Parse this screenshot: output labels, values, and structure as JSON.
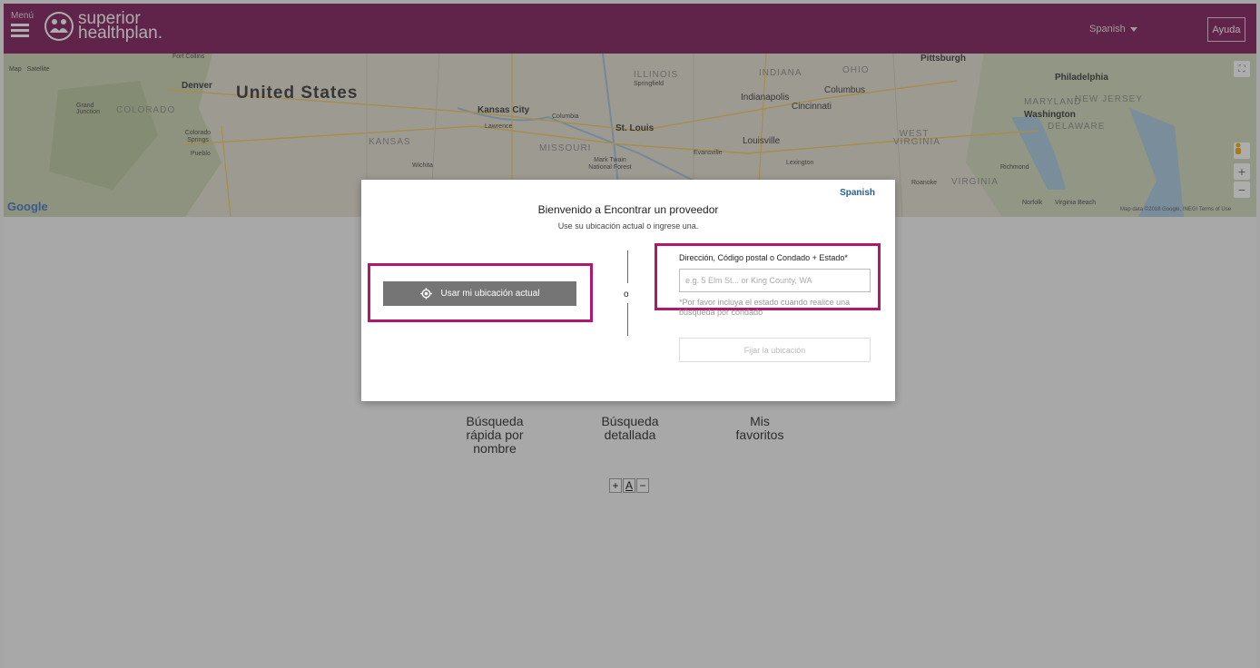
{
  "header": {
    "menu_label": "Menú",
    "logo_line1": "superior",
    "logo_line2": "healthplan.",
    "language": "Spanish",
    "help": "Ayuda"
  },
  "map": {
    "type_map": "Map",
    "type_satellite": "Satellite",
    "google": "Google",
    "attribution": "Map data ©2018 Google, INEGI   Terms of Use",
    "labels": {
      "fort_collins": "Fort Collins",
      "denver": "Denver",
      "united_states": "United States",
      "grand_junction": "Grand Junction",
      "colorado": "COLORADO",
      "colorado_springs": "Colorado Springs",
      "pueblo": "Pueblo",
      "kansas": "KANSAS",
      "wichita": "Wichita",
      "kansas_city": "Kansas City",
      "lawrence": "Lawrence",
      "columbia": "Columbia",
      "missouri": "MISSOURI",
      "st_louis": "St. Louis",
      "mark_twain": "Mark Twain National Forest",
      "illinois": "ILLINOIS",
      "springfield": "Springfield",
      "indiana": "INDIANA",
      "indianapolis": "Indianapolis",
      "ohio": "OHIO",
      "columbus": "Columbus",
      "cincinnati": "Cincinnati",
      "louisville": "Louisville",
      "evansville": "Evansville",
      "lexington": "Lexington",
      "pittsburgh": "Pittsburgh",
      "west_virginia": "WEST VIRGINIA",
      "philadelphia": "Philadelphia",
      "maryland": "MARYLAND",
      "new_jersey": "NEW JERSEY",
      "washington": "Washington",
      "delaware": "DELAWARE",
      "richmond": "Richmond",
      "virginia": "VIRGINIA",
      "roanoke": "Roanoke",
      "norfolk": "Norfolk",
      "virginia_beach": "Virginia Beach"
    }
  },
  "nav": {
    "quick_search": "Búsqueda rápida por nombre",
    "detailed_search": "Búsqueda detallada",
    "favorites": "Mis favoritos"
  },
  "font_controls": {
    "plus": "+",
    "a": "A",
    "minus": "−"
  },
  "modal": {
    "language": "Spanish",
    "title": "Bienvenido a Encontrar un proveedor",
    "subtitle": "Use su ubicación actual o ingrese una.",
    "use_location_button": "Usar mi ubicación actual",
    "or": "o",
    "field_label": "Dirección, Código postal o Condado + Estado*",
    "field_placeholder": "e.g. 5 Elm St... or King County, WA",
    "field_value": "",
    "hint": "*Por favor incluya el estado cuando realice una búsqueda por condado",
    "set_location_button": "Fijar la ubicación"
  },
  "colors": {
    "brand": "#7a1455",
    "highlight": "#b0176e",
    "link": "#2a5b8c"
  }
}
